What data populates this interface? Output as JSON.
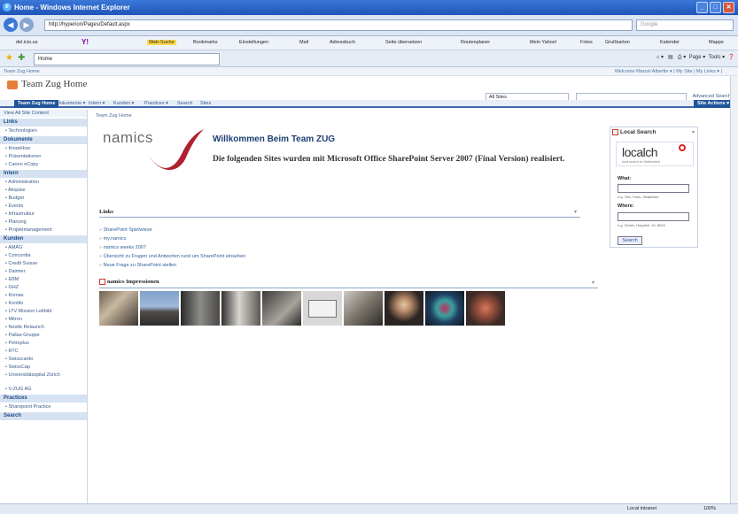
{
  "window": {
    "title": "Home - Windows Internet Explorer"
  },
  "address": {
    "url": "http://hyperion/Pages/Default.aspx",
    "search_placeholder": "Google"
  },
  "ytoolbar": {
    "deliciou": "del.icio.us",
    "yahoo": "Y!",
    "websuche": "Web-Suche",
    "items": [
      "Bookmarks",
      "Einstellungen",
      "Mail",
      "Adressbuch",
      "Seite übersetzen",
      "Routenplaner",
      "Mein Yahoo!",
      "Fotos",
      "Grußkarten",
      "Kalender",
      "Mappe"
    ]
  },
  "tab": {
    "label": "Home"
  },
  "cmdbar": {
    "page": "Page",
    "tools": "Tools"
  },
  "welcomebar": {
    "site": "Team Zug Home",
    "right": "Welcome Marcel Albertin ▾  |  My Site  |  My Links ▾  |"
  },
  "site": {
    "title": "Team Zug Home",
    "nav_home": "Team Zug Home",
    "nav_items": [
      "Dokumente ▾",
      "Intern ▾",
      "Kunden ▾",
      "Practices ▾",
      "Search",
      "Sites"
    ],
    "site_actions": "Site Actions ▾",
    "scope": "All Sites",
    "advanced_search": "Advanced Search"
  },
  "leftnav": {
    "view_all": "View All Site Content",
    "groups": [
      {
        "title": "Links",
        "items": [
          "Technologien"
        ]
      },
      {
        "title": "Dokumente",
        "items": [
          "KnowHow",
          "Präsentationen",
          "Canon eCopy"
        ]
      },
      {
        "title": "Intern",
        "items": [
          "Administration",
          "Akquise",
          "Budget",
          "Events",
          "Infrastruktur",
          "Planung",
          "Projektmanagement"
        ]
      },
      {
        "title": "Kunden",
        "items": [
          "AMAG",
          "Concordia",
          "Credit Suisse",
          "Daimler",
          "EBM",
          "GHZ",
          "Komax",
          "Kontiki",
          "LTV Mission Leitbild",
          "Mitron",
          "Nestle Relaunch",
          "Pallas-Gruppe",
          "Petroplus",
          "RTC",
          "Swisscanto",
          "SwissCap",
          "Universitätsspital Zürich",
          "V-ZUG AG"
        ]
      },
      {
        "title": "Practices",
        "items": [
          "Sharepoint Practice"
        ]
      },
      {
        "title": "Search",
        "items": []
      }
    ]
  },
  "main": {
    "breadcrumb": "Team Zug Home",
    "logo": "namics",
    "welcome_title": "Willkommen Beim Team ZUG",
    "welcome_text": "Die folgenden Sites wurden mit Microsoft Office SharePoint Server 2007 (Final Version) realisiert.",
    "links_title": "Links",
    "links": [
      "SharePoint Spielwiese",
      "my.namics",
      "namics weeks 2007",
      "Übersicht zu Fragen und Antworten rund um SharePoint einsehen",
      "Neue Frage zu SharePoint stellen"
    ],
    "impressions_title": "namics Impressionen"
  },
  "localsearch": {
    "title": "Local Search",
    "logo_text": "localch",
    "logo_tag": "local search for Switzerland",
    "what_label": "What:",
    "what_hint": "e.g. Taxi, Paris, Skiabfahrt",
    "where_label": "Where:",
    "where_hint": "e.g. Zürich, Hauptstr. 10, 8004",
    "button": "Search"
  },
  "status": {
    "zone": "Local intranet",
    "zoom": "100%"
  },
  "colors": {
    "accent": "#21559b",
    "logo_red": "#b0202f"
  }
}
